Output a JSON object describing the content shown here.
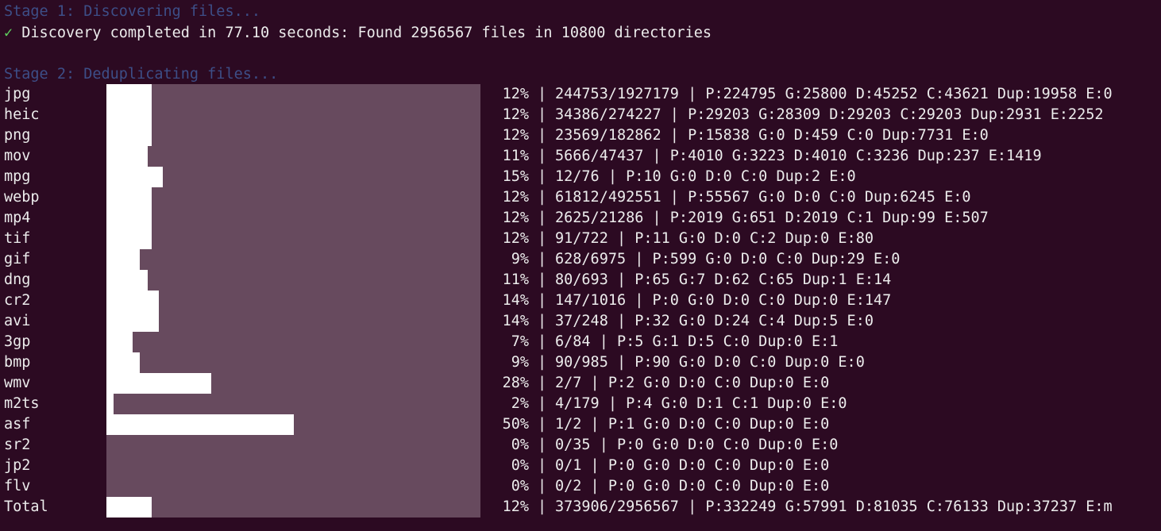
{
  "stage1": {
    "text": "Stage 1: Discovering files...",
    "check": "✓",
    "result": "Discovery completed in 77.10 seconds: Found 2956567 files in 10800 directories"
  },
  "stage2": {
    "text": "Stage 2: Deduplicating files..."
  },
  "separator": "|",
  "colors": {
    "background": "#2c0a22",
    "stage_text": "#3d4e87",
    "check": "#5fd35f",
    "bar_fill": "#ffffff",
    "bar_track": "#674a5e",
    "text": "#ececec"
  },
  "rows": [
    {
      "ext": "jpg",
      "pct": "12%",
      "fill": 0.12,
      "stats": "244753/1927179 | P:224795 G:25800 D:45252 C:43621 Dup:19958 E:0"
    },
    {
      "ext": "heic",
      "pct": "12%",
      "fill": 0.12,
      "stats": "34386/274227 | P:29203 G:28309 D:29203 C:29203 Dup:2931 E:2252"
    },
    {
      "ext": "png",
      "pct": "12%",
      "fill": 0.12,
      "stats": "23569/182862 | P:15838 G:0 D:459 C:0 Dup:7731 E:0"
    },
    {
      "ext": "mov",
      "pct": "11%",
      "fill": 0.11,
      "stats": "5666/47437 | P:4010 G:3223 D:4010 C:3236 Dup:237 E:1419"
    },
    {
      "ext": "mpg",
      "pct": "15%",
      "fill": 0.15,
      "stats": "12/76 | P:10 G:0 D:0 C:0 Dup:2 E:0"
    },
    {
      "ext": "webp",
      "pct": "12%",
      "fill": 0.12,
      "stats": "61812/492551 | P:55567 G:0 D:0 C:0 Dup:6245 E:0"
    },
    {
      "ext": "mp4",
      "pct": "12%",
      "fill": 0.12,
      "stats": "2625/21286 | P:2019 G:651 D:2019 C:1 Dup:99 E:507"
    },
    {
      "ext": "tif",
      "pct": "12%",
      "fill": 0.12,
      "stats": "91/722 | P:11 G:0 D:0 C:2 Dup:0 E:80"
    },
    {
      "ext": "gif",
      "pct": " 9%",
      "fill": 0.09,
      "stats": "628/6975 | P:599 G:0 D:0 C:0 Dup:29 E:0"
    },
    {
      "ext": "dng",
      "pct": "11%",
      "fill": 0.11,
      "stats": "80/693 | P:65 G:7 D:62 C:65 Dup:1 E:14"
    },
    {
      "ext": "cr2",
      "pct": "14%",
      "fill": 0.14,
      "stats": "147/1016 | P:0 G:0 D:0 C:0 Dup:0 E:147"
    },
    {
      "ext": "avi",
      "pct": "14%",
      "fill": 0.14,
      "stats": "37/248 | P:32 G:0 D:24 C:4 Dup:5 E:0"
    },
    {
      "ext": "3gp",
      "pct": " 7%",
      "fill": 0.07,
      "stats": "6/84 | P:5 G:1 D:5 C:0 Dup:0 E:1"
    },
    {
      "ext": "bmp",
      "pct": " 9%",
      "fill": 0.09,
      "stats": "90/985 | P:90 G:0 D:0 C:0 Dup:0 E:0"
    },
    {
      "ext": "wmv",
      "pct": "28%",
      "fill": 0.28,
      "stats": "2/7 | P:2 G:0 D:0 C:0 Dup:0 E:0"
    },
    {
      "ext": "m2ts",
      "pct": " 2%",
      "fill": 0.02,
      "stats": "4/179 | P:4 G:0 D:1 C:1 Dup:0 E:0"
    },
    {
      "ext": "asf",
      "pct": "50%",
      "fill": 0.5,
      "stats": "1/2 | P:1 G:0 D:0 C:0 Dup:0 E:0"
    },
    {
      "ext": "sr2",
      "pct": " 0%",
      "fill": 0.0,
      "stats": "0/35 | P:0 G:0 D:0 C:0 Dup:0 E:0"
    },
    {
      "ext": "jp2",
      "pct": " 0%",
      "fill": 0.0,
      "stats": "0/1 | P:0 G:0 D:0 C:0 Dup:0 E:0"
    },
    {
      "ext": "flv",
      "pct": " 0%",
      "fill": 0.0,
      "stats": "0/2 | P:0 G:0 D:0 C:0 Dup:0 E:0"
    },
    {
      "ext": "Total",
      "pct": "12%",
      "fill": 0.12,
      "stats": "373906/2956567 | P:332249 G:57991 D:81035 C:76133 Dup:37237 E:m"
    }
  ]
}
